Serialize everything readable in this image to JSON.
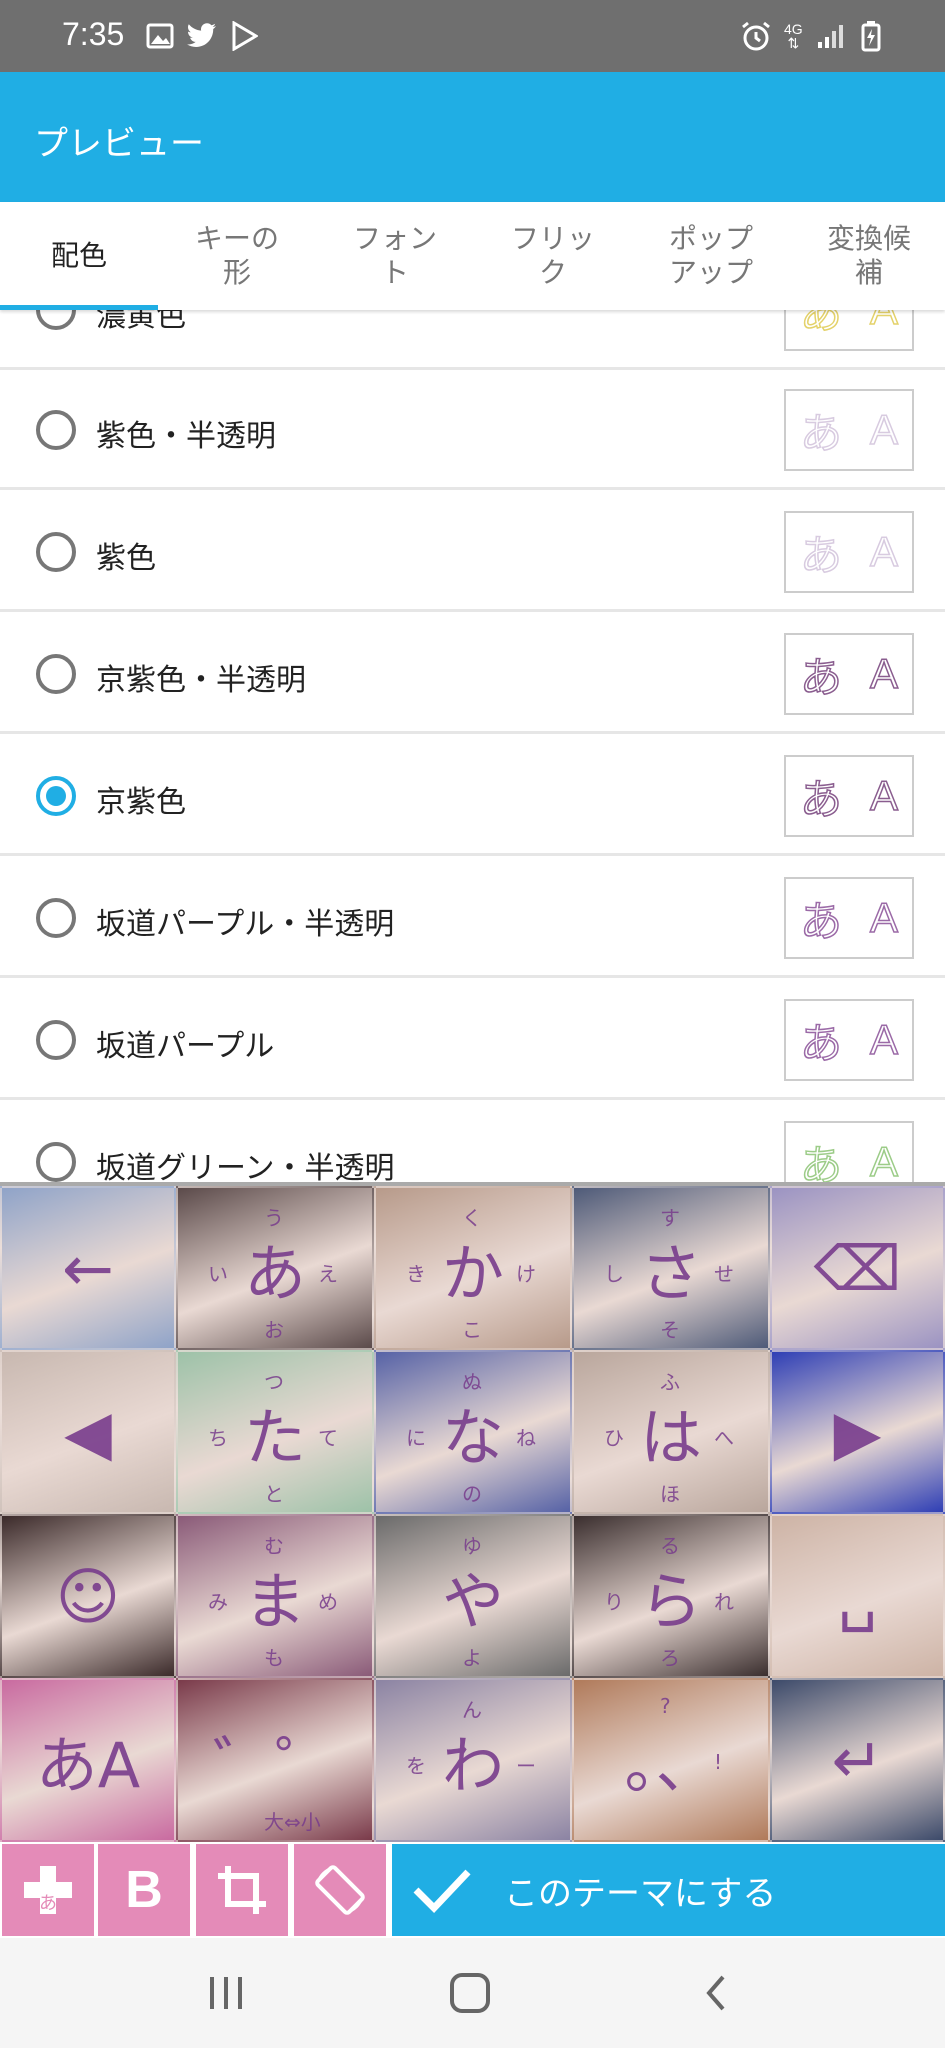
{
  "status_bar": {
    "time": "7:35",
    "network": "4G"
  },
  "app_bar": {
    "title": "プレビュー"
  },
  "tabs": [
    "配色",
    "キーの形",
    "フォント",
    "フリック",
    "ポップアップ",
    "変換候補"
  ],
  "tab_display": [
    "配色",
    "キーの\n形",
    "フォン\nト",
    "フリッ\nク",
    "ポップ\nアップ",
    "変換候\n補"
  ],
  "active_tab_index": 0,
  "color_options": [
    {
      "label": "濃黄色",
      "selected": false,
      "preview_color": "#e4d26a"
    },
    {
      "label": "紫色・半透明",
      "selected": false,
      "preview_color": "#d8cbe0"
    },
    {
      "label": "紫色",
      "selected": false,
      "preview_color": "#d8cbe0"
    },
    {
      "label": "京紫色・半透明",
      "selected": false,
      "preview_color": "#8a5d8f"
    },
    {
      "label": "京紫色",
      "selected": true,
      "preview_color": "#8a5d8f"
    },
    {
      "label": "坂道パープル・半透明",
      "selected": false,
      "preview_color": "#9b6aa7"
    },
    {
      "label": "坂道パープル",
      "selected": false,
      "preview_color": "#9b6aa7"
    },
    {
      "label": "坂道グリーン・半透明",
      "selected": false,
      "preview_color": "#9ccc88"
    }
  ],
  "preview_sample": {
    "kana": "あ",
    "latin": "A"
  },
  "keyboard": {
    "rows": [
      [
        {
          "main": "←",
          "bg": "#8fa3c8"
        },
        {
          "main": "あ",
          "subs": [
            "い",
            "う",
            "え",
            "お"
          ],
          "bg": "#5b4a4a"
        },
        {
          "main": "か",
          "subs": [
            "き",
            "く",
            "け",
            "こ"
          ],
          "bg": "#b79a8a"
        },
        {
          "main": "さ",
          "subs": [
            "し",
            "す",
            "せ",
            "そ"
          ],
          "bg": "#4e5a78"
        },
        {
          "main": "⌫",
          "bg": "#9b93c2"
        }
      ],
      [
        {
          "main": "◀",
          "bg": "#c8b8b0"
        },
        {
          "main": "た",
          "subs": [
            "ち",
            "つ",
            "て",
            "と"
          ],
          "bg": "#9dc2a8"
        },
        {
          "main": "な",
          "subs": [
            "に",
            "ぬ",
            "ね",
            "の"
          ],
          "bg": "#5662a6"
        },
        {
          "main": "は",
          "subs": [
            "ひ",
            "ふ",
            "へ",
            "ほ"
          ],
          "bg": "#b9a69c"
        },
        {
          "main": "▶",
          "bg": "#2f3fb5"
        }
      ],
      [
        {
          "main": "☺",
          "bg": "#3b2a2a"
        },
        {
          "main": "ま",
          "subs": [
            "み",
            "む",
            "め",
            "も"
          ],
          "bg": "#8a5a78"
        },
        {
          "main": "や",
          "subs": [
            "",
            "ゆ",
            "",
            "よ"
          ],
          "bg": "#6a6a6a"
        },
        {
          "main": "ら",
          "subs": [
            "り",
            "る",
            "れ",
            "ろ"
          ],
          "bg": "#3a2e2e"
        },
        {
          "main": "␣",
          "bg": "#cdb3a5"
        }
      ],
      [
        {
          "main": "あA",
          "bg": "#c96aa0"
        },
        {
          "main": "゛゜",
          "subs": [
            "",
            "",
            "",
            "大⇔小"
          ],
          "bg": "#7a3a4a"
        },
        {
          "main": "わ",
          "subs": [
            "を",
            "ん",
            "ー",
            ""
          ],
          "bg": "#8b83a3"
        },
        {
          "main": "。、",
          "subs": [
            "",
            "?",
            "!",
            ""
          ],
          "bg": "#b07a5a"
        },
        {
          "main": "↵",
          "bg": "#3c4a6a"
        }
      ]
    ]
  },
  "toolbar": {
    "apply_label": "このテーマにする",
    "tools": [
      "add-kana",
      "bold",
      "crop",
      "rotate"
    ],
    "bold_label": "B",
    "add_label": "あ"
  },
  "colors": {
    "accent": "#20aee4",
    "tool_pink": "#e48bb8",
    "status_bar": "#6f6f6f"
  }
}
